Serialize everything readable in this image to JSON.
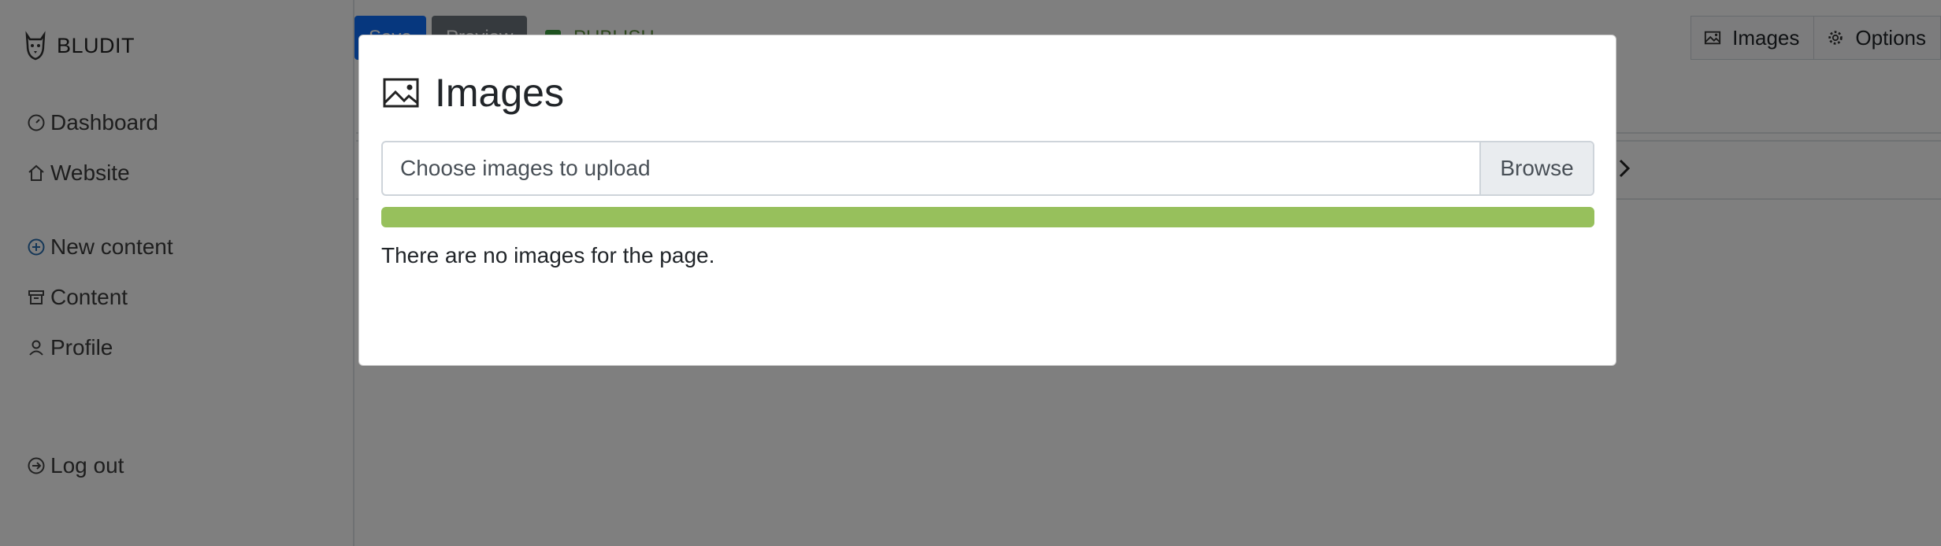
{
  "sidebar": {
    "brand": "BLUDIT",
    "items": [
      {
        "label": "Dashboard",
        "icon": "dashboard-icon"
      },
      {
        "label": "Website",
        "icon": "home-icon"
      },
      {
        "label": "New content",
        "icon": "plus-circle-icon"
      },
      {
        "label": "Content",
        "icon": "archive-icon"
      },
      {
        "label": "Profile",
        "icon": "user-icon"
      },
      {
        "label": "Log out",
        "icon": "logout-icon"
      }
    ]
  },
  "toolbar": {
    "save_label": "Save",
    "preview_label": "Preview",
    "publish_label": "PUBLISH",
    "images_label": "Images",
    "options_label": "Options"
  },
  "modal": {
    "title": "Images",
    "file_placeholder": "Choose images to upload",
    "browse_label": "Browse",
    "progress": 1.0,
    "empty_message": "There are no images for the page."
  },
  "colors": {
    "primary": "#0d6efd",
    "secondary": "#6c757d",
    "progress": "#97c05c",
    "publish": "#3ca540"
  }
}
